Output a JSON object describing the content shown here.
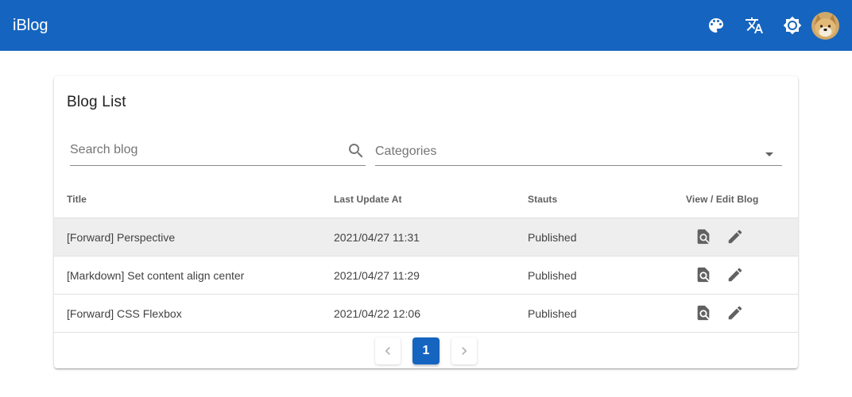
{
  "header": {
    "title": "iBlog",
    "icons": [
      "palette-icon",
      "translate-icon",
      "brightness-icon"
    ],
    "avatar": "shiba-avatar"
  },
  "card": {
    "title": "Blog List",
    "search": {
      "placeholder": "Search blog",
      "value": ""
    },
    "categories": {
      "placeholder": "Categories"
    }
  },
  "table": {
    "columns": [
      "Title",
      "Last Update At",
      "Stauts",
      "View / Edit Blog"
    ],
    "rows": [
      {
        "title": "[Forward] Perspective",
        "updated": "2021/04/27 11:31",
        "status": "Published"
      },
      {
        "title": "[Markdown] Set content align center",
        "updated": "2021/04/27 11:29",
        "status": "Published"
      },
      {
        "title": "[Forward] CSS Flexbox",
        "updated": "2021/04/22 12:06",
        "status": "Published"
      }
    ],
    "selected_row": 0
  },
  "pagination": {
    "current_page": "1"
  },
  "colors": {
    "primary": "#1565c0",
    "row_highlight": "#eeeeee",
    "icon": "#616161"
  }
}
